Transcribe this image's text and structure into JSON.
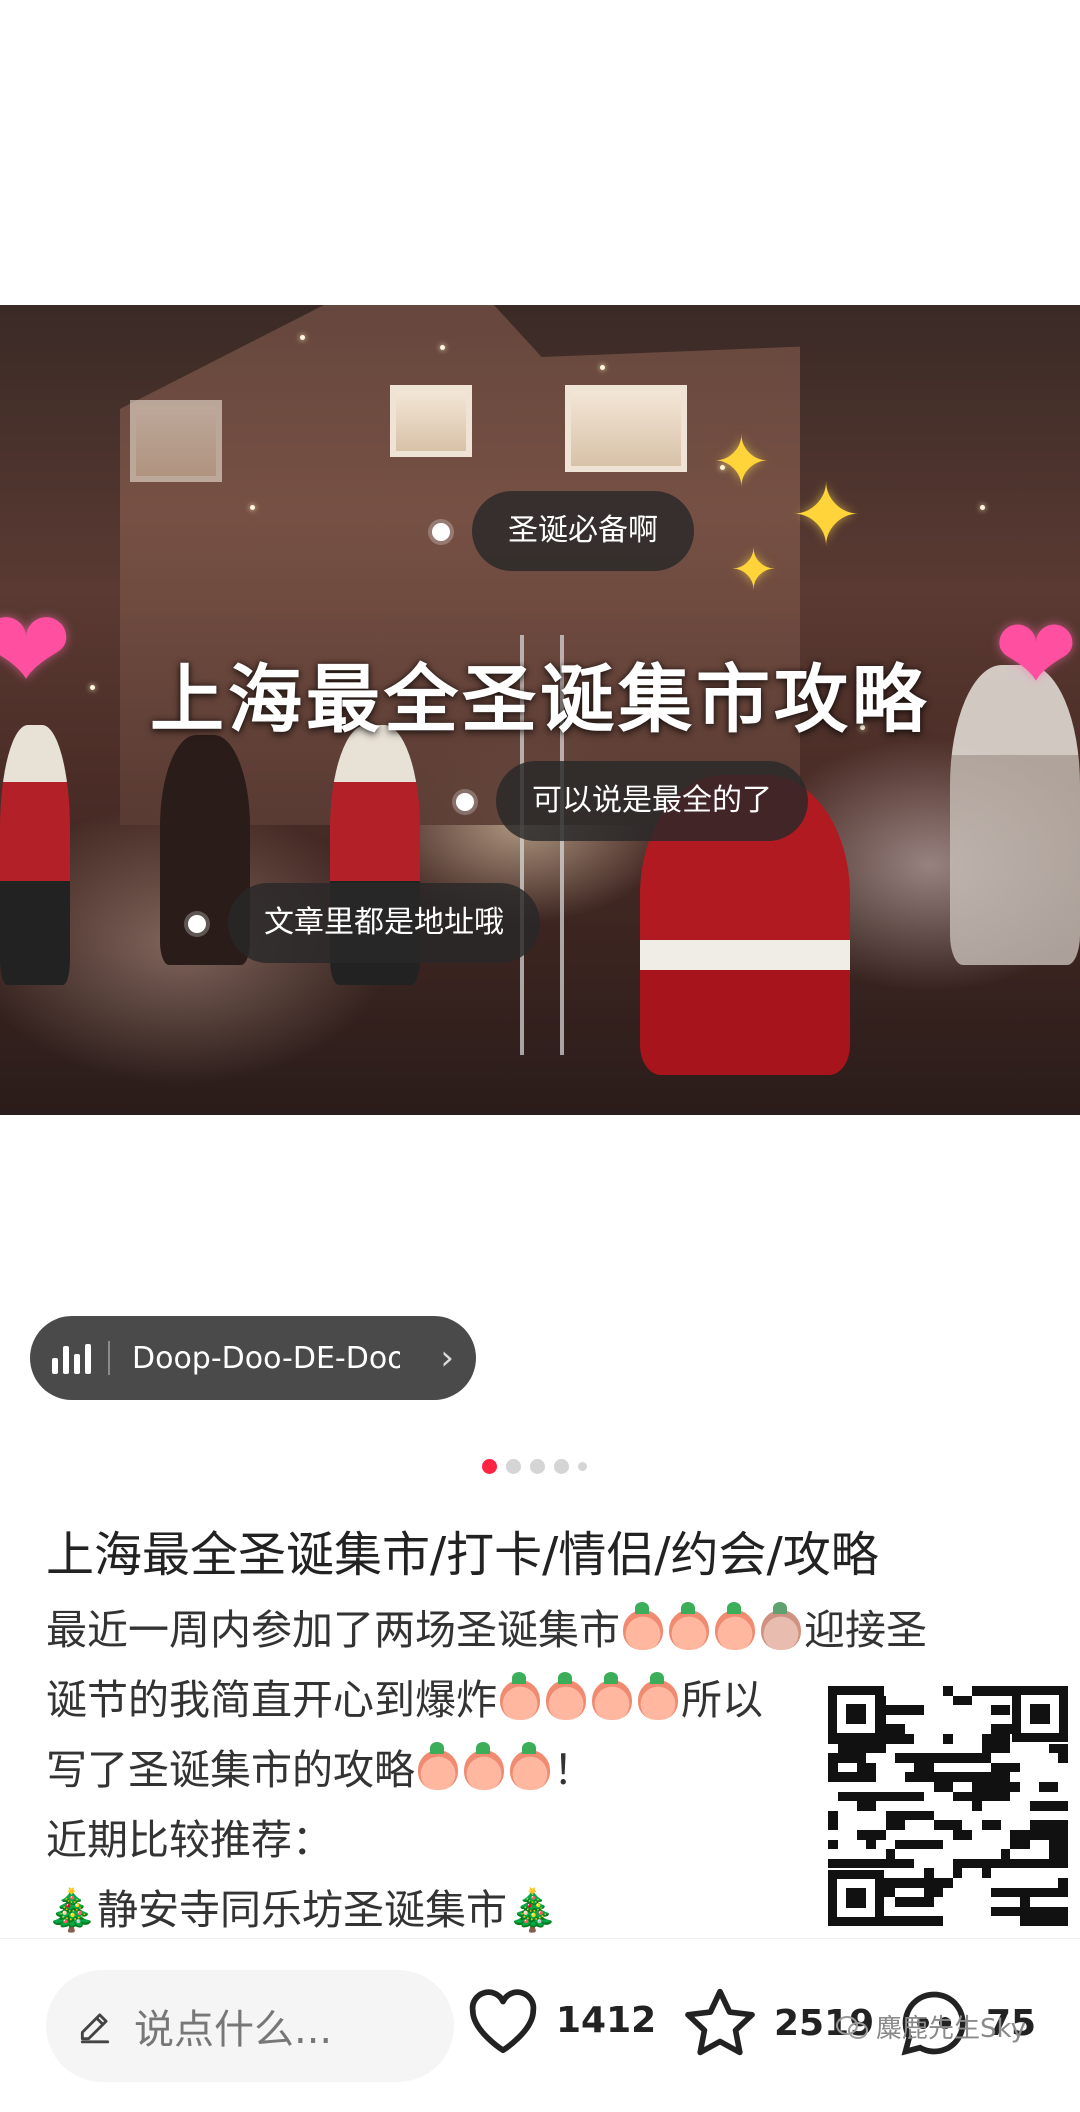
{
  "photo": {
    "title_overlay": "上海最全圣诞集市攻略",
    "tags": [
      {
        "text": "圣诞必备啊"
      },
      {
        "text": "可以说是最全的了"
      },
      {
        "text": "文章里都是地址哦"
      }
    ]
  },
  "music": {
    "title": "Doop-Doo-DE-Doo",
    "chevron": "›"
  },
  "carousel": {
    "total": 5,
    "active": 1
  },
  "post": {
    "title": "上海最全圣诞集市/打卡/情侣/约会/攻略",
    "lines": [
      {
        "pre": "最近一周内参加了两场圣诞集市",
        "emoji_count": 4,
        "post": "迎接圣"
      },
      {
        "pre": "诞节的我简直开心到爆炸",
        "emoji_count": 4,
        "post": "所以"
      },
      {
        "pre": "写了圣诞集市的攻略",
        "emoji_count": 3,
        "post": "！"
      },
      {
        "pre": "近期比较推荐：",
        "emoji_count": 0,
        "post": ""
      },
      {
        "pre": "静安寺同乐坊圣诞集市",
        "emoji_count": 0,
        "post": ""
      }
    ],
    "tree_emoji": "🎄"
  },
  "bottom_bar": {
    "comment_placeholder": "说点什么...",
    "likes": "1412",
    "favorites": "2519",
    "comments": "75",
    "watermark": "麋鹿先生Sky"
  },
  "icons": {
    "like": "heart-outline-icon",
    "favorite": "star-outline-icon",
    "comment": "chat-bubble-icon",
    "edit": "pencil-icon",
    "music": "audio-bars-icon"
  },
  "colors": {
    "accent": "#ff2442",
    "pill_bg": "#4a4a4a",
    "tag_bg": "#282828",
    "star": "#ffd43a",
    "heart": "#ff4fa0"
  }
}
